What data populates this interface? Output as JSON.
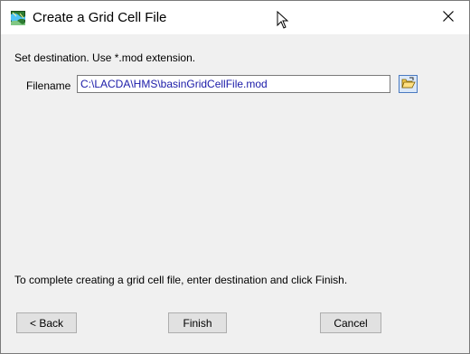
{
  "window": {
    "title": "Create a Grid Cell File"
  },
  "instruction": "Set destination. Use *.mod extension.",
  "filename": {
    "label": "Filename",
    "value": "C:\\LACDA\\HMS\\basinGridCellFile.mod"
  },
  "footer_text": "To complete creating a grid cell file, enter destination and click Finish.",
  "buttons": {
    "back": "< Back",
    "finish": "Finish",
    "cancel": "Cancel"
  },
  "icons": {
    "app": "grid-map-icon",
    "browse": "folder-open-icon",
    "close": "close-icon",
    "cursor": "mouse-pointer-icon"
  },
  "colors": {
    "input_text": "#1a1aa8",
    "browse_border": "#4a7ac0"
  }
}
